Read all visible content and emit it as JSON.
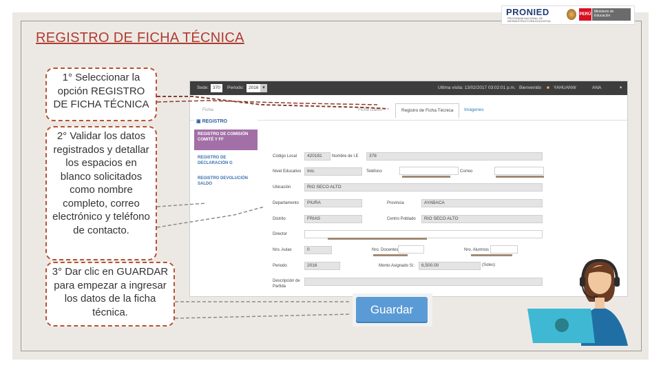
{
  "header": {
    "title": "REGISTRO DE FICHA TÉCNICA",
    "logos": {
      "pronied": "PRONIED",
      "pronied_tagline": "PROGRAMA NACIONAL DE INFRAESTRUCTURA EDUCATIVA",
      "peru": "PERÚ",
      "ministry": "Ministerio de Educación"
    }
  },
  "callouts": [
    {
      "text": "1° Seleccionar la opción REGISTRO DE FICHA TÉCNICA"
    },
    {
      "text": "2° Validar los datos registrados y detallar los espacios en blanco solicitados como nombre completo, correo electrónico y teléfono de contacto."
    },
    {
      "text": "3° Dar clic en GUARDAR para empezar a ingresar los datos de la ficha técnica."
    }
  ],
  "app": {
    "topbar": {
      "sede_label": "Sede:",
      "sede_value": "370",
      "periodo_label": "Periodo:",
      "periodo_value": "2016",
      "last_visit": "Ultima visita: 13/02/2017 03:02:01 p.m.",
      "welcome": "Bienvenido",
      "user": "YAHUANW",
      "user2": "ANA"
    },
    "tabs": [
      {
        "label": "Ficha",
        "state": "cut"
      },
      {
        "label": "Ficha Datos",
        "state": "cut"
      },
      {
        "label": "Registro de Ficha Técnica",
        "state": "active"
      },
      {
        "label": "Imágenes",
        "state": "link"
      }
    ],
    "sidebar": {
      "heading": "REGISTRO",
      "items": [
        {
          "label": "REGISTRO DE COMISIÓN COMITÉ Y FF",
          "selected": true
        },
        {
          "label": "REGISTRO DE DECLARACIÓN G",
          "selected": false
        },
        {
          "label": "REGISTRO DEVOLUCIÓN SALDO",
          "selected": false
        }
      ]
    },
    "form": {
      "codigo_local_label": "Código Local",
      "codigo_local": "420181",
      "nombre_ie_label": "Nombre de I.E",
      "nombre_ie": "378",
      "nivel_label": "Nivel Educativo",
      "nivel": "Inic.",
      "telefono_label": "Teléfono",
      "telefono": "",
      "correo_label": "Correo",
      "correo": "",
      "ubicacion_label": "Ubicación",
      "ubicacion": "RIO SECO ALTO",
      "departamento_label": "Departamento",
      "departamento": "PIURA",
      "provincia_label": "Provincia",
      "provincia": "AYABACA",
      "distrito_label": "Distrito",
      "distrito": "FRIAS",
      "centro_poblado_label": "Centro Poblado",
      "centro_poblado": "RIO SECO ALTO",
      "director_label": "Director",
      "director": "",
      "aulas_label": "Nro. Aulas",
      "aulas": "0",
      "docentes_label": "Nro. Docentes",
      "docentes": "",
      "alumnos_label": "Nro. Alumnos",
      "alumnos": "",
      "periodo_label": "Periodo",
      "periodo": "2016",
      "monto_label": "Monto Asignado S/.",
      "monto": "6,500.00",
      "monto_unit": "(Soles)",
      "descripcion_label": "Descripción de Partida",
      "descripcion": ""
    },
    "save_button": "Guardar"
  },
  "colors": {
    "title": "#b03a2e",
    "callout_border": "#b8502f",
    "leader": "#b06a5a",
    "sidebar_selected": "#a26fa6",
    "button": "#5b9bd5"
  }
}
